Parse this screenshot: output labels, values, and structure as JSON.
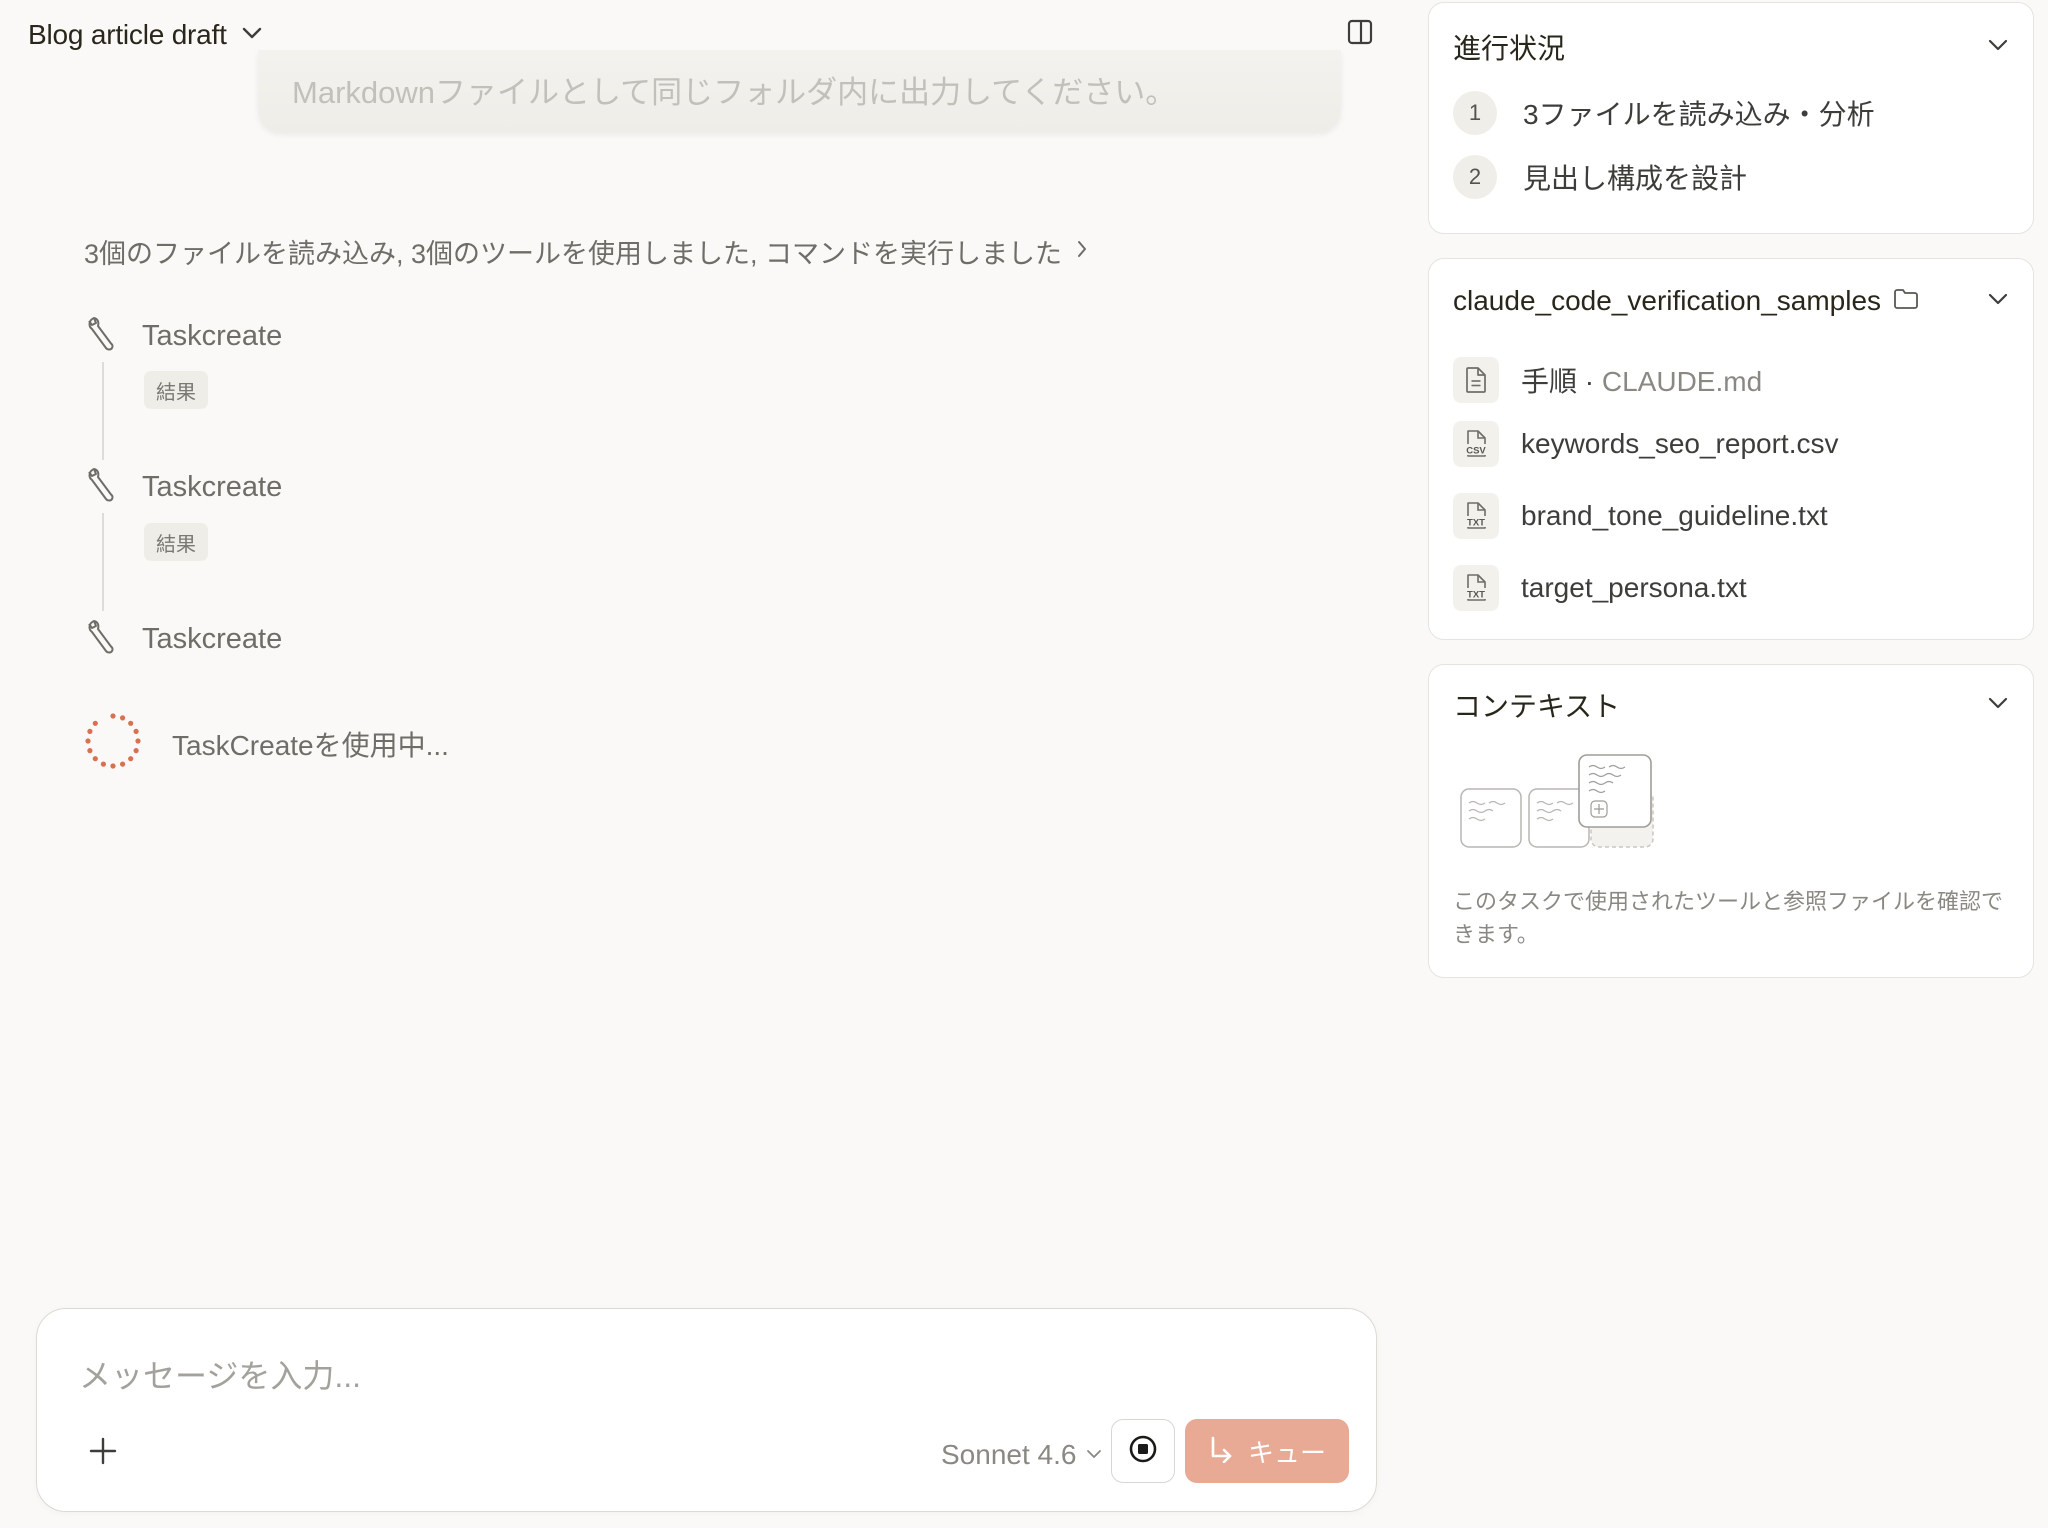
{
  "header": {
    "title": "Blog article draft"
  },
  "previous_message": {
    "text": "Markdownファイルとして同じフォルダ内に出力してください。"
  },
  "activity": {
    "summary": "3個のファイルを読み込み, 3個のツールを使用しました, コマンドを実行しました",
    "tools": [
      {
        "name": "Taskcreate",
        "result_label": "結果"
      },
      {
        "name": "Taskcreate",
        "result_label": "結果"
      },
      {
        "name": "Taskcreate"
      }
    ],
    "loading_text": "TaskCreateを使用中..."
  },
  "composer": {
    "placeholder": "メッセージを入力...",
    "model": "Sonnet 4.6",
    "queue_label": "キュー"
  },
  "progress_panel": {
    "title": "進行状況",
    "steps": [
      {
        "num": "1",
        "label": "3ファイルを読み込み・分析"
      },
      {
        "num": "2",
        "label": "見出し構成を設計"
      }
    ]
  },
  "folder_panel": {
    "title": "claude_code_verification_samples",
    "files": [
      {
        "prefix": "手順 · ",
        "name": "CLAUDE.md",
        "icon": "doc-icon"
      },
      {
        "name": "keywords_seo_report.csv",
        "icon": "csv-icon",
        "icon_text": "CSV"
      },
      {
        "name": "brand_tone_guideline.txt",
        "icon": "txt-icon",
        "icon_text": "TXT"
      },
      {
        "name": "target_persona.txt",
        "icon": "txt-icon",
        "icon_text": "TXT"
      }
    ]
  },
  "context_panel": {
    "title": "コンテキスト",
    "description": "このタスクで使用されたツールと参照ファイルを確認できます。"
  },
  "colors": {
    "background": "#faf9f7",
    "accent": "#e8a995",
    "spinner": "#d9704f"
  }
}
